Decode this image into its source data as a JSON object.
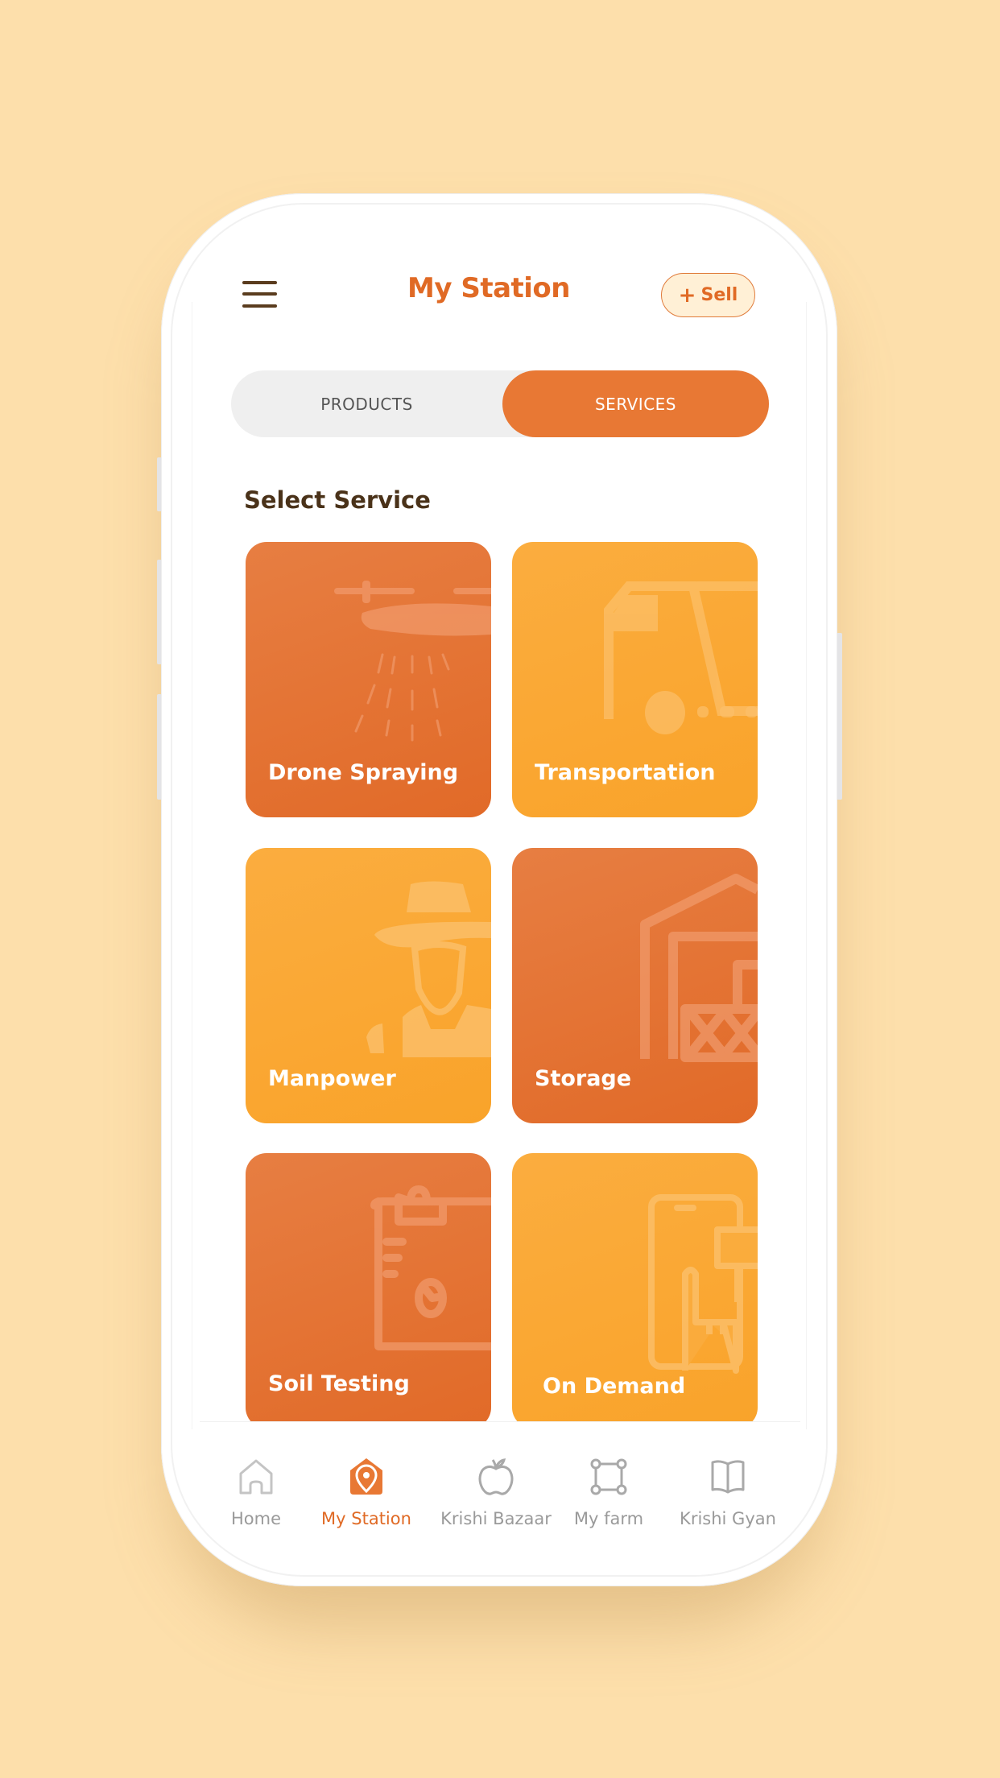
{
  "header": {
    "title": "My Station",
    "menu_icon": "hamburger-menu-icon",
    "sell_button": {
      "icon": "plus",
      "label": "Sell"
    }
  },
  "segmented_control": {
    "tabs": [
      {
        "label": "PRODUCTS",
        "active": false
      },
      {
        "label": "SERVICES",
        "active": true
      }
    ]
  },
  "section": {
    "heading": "Select Service",
    "services": [
      {
        "label": "Drone Spraying",
        "icon": "drone-icon",
        "tone": "dark"
      },
      {
        "label": "Transportation",
        "icon": "truck-icon",
        "tone": "light"
      },
      {
        "label": "Manpower",
        "icon": "farmer-icon",
        "tone": "light"
      },
      {
        "label": "Storage",
        "icon": "warehouse-icon",
        "tone": "dark"
      },
      {
        "label": "Soil Testing",
        "icon": "clipboard-icon",
        "tone": "dark"
      },
      {
        "label": "On Demand",
        "icon": "phone-tap-icon",
        "tone": "light"
      }
    ]
  },
  "bottom_nav": {
    "items": [
      {
        "label": "Home",
        "icon": "home-icon",
        "active": false
      },
      {
        "label": "My Station",
        "icon": "station-icon",
        "active": true
      },
      {
        "label": "Krishi Bazaar",
        "icon": "apple-icon",
        "active": false
      },
      {
        "label": "My farm",
        "icon": "farm-plot-icon",
        "active": false
      },
      {
        "label": "Krishi Gyan",
        "icon": "book-icon",
        "active": false
      }
    ]
  },
  "colors": {
    "background": "#FDDFAB",
    "accent": "#E87834",
    "accent_text": "#E06A25",
    "card_dark": "#E16A28",
    "card_light": "#F9A32A",
    "heading": "#4A3219",
    "nav_inactive": "#9A9A9A"
  }
}
